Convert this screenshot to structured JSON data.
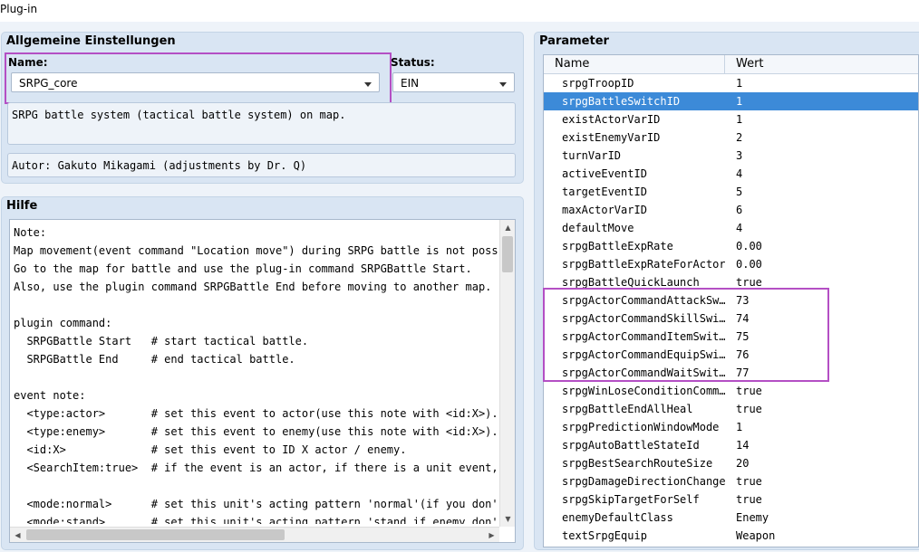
{
  "window": {
    "title": "Plug-in"
  },
  "general": {
    "title": "Allgemeine Einstellungen",
    "name_label": "Name:",
    "name_value": "SRPG_core",
    "status_label": "Status:",
    "status_value": "EIN",
    "description": "SRPG battle system (tactical battle system) on map.",
    "author": "Autor: Gakuto Mikagami (adjustments by Dr. Q)"
  },
  "help": {
    "title": "Hilfe",
    "lines": [
      "Note:",
      "Map movement(event command \"Location move\") during SRPG battle is not possible",
      "Go to the map for battle and use the plug-in command SRPGBattle Start.",
      "Also, use the plugin command SRPGBattle End before moving to another map.",
      "",
      "plugin command:",
      "  SRPGBattle Start   # start tactical battle.",
      "  SRPGBattle End     # end tactical battle.",
      "",
      "event note:",
      "  <type:actor>       # set this event to actor(use this note with <id:X>).",
      "  <type:enemy>       # set this event to enemy(use this note with <id:X>).",
      "  <id:X>             # set this event to ID X actor / enemy.",
      "  <SearchItem:true>  # if the event is an actor, if there is a unit event, it w",
      "",
      "  <mode:normal>      # set this unit's acting pattern 'normal'(if you don't set",
      "  <mode:stand>       # set this unit's acting pattern 'stand if enemy don't nea"
    ]
  },
  "parameters": {
    "title": "Parameter",
    "col_name": "Name",
    "col_value": "Wert",
    "rows": [
      {
        "name": "srpgTroopID",
        "value": "1"
      },
      {
        "name": "srpgBattleSwitchID",
        "value": "1"
      },
      {
        "name": "existActorVarID",
        "value": "1"
      },
      {
        "name": "existEnemyVarID",
        "value": "2"
      },
      {
        "name": "turnVarID",
        "value": "3"
      },
      {
        "name": "activeEventID",
        "value": "4"
      },
      {
        "name": "targetEventID",
        "value": "5"
      },
      {
        "name": "maxActorVarID",
        "value": "6"
      },
      {
        "name": "defaultMove",
        "value": "4"
      },
      {
        "name": "srpgBattleExpRate",
        "value": "0.00"
      },
      {
        "name": "srpgBattleExpRateForActors",
        "value": "0.00"
      },
      {
        "name": "srpgBattleQuickLaunch",
        "value": "true"
      },
      {
        "name": "srpgActorCommandAttackSw…",
        "value": "73"
      },
      {
        "name": "srpgActorCommandSkillSwi…",
        "value": "74"
      },
      {
        "name": "srpgActorCommandItemSwit…",
        "value": "75"
      },
      {
        "name": "srpgActorCommandEquipSwi…",
        "value": "76"
      },
      {
        "name": "srpgActorCommandWaitSwit…",
        "value": "77"
      },
      {
        "name": "srpgWinLoseConditionComm…",
        "value": "true"
      },
      {
        "name": "srpgBattleEndAllHeal",
        "value": "true"
      },
      {
        "name": "srpgPredictionWindowMode",
        "value": "1"
      },
      {
        "name": "srpgAutoBattleStateId",
        "value": "14"
      },
      {
        "name": "srpgBestSearchRouteSize",
        "value": "20"
      },
      {
        "name": "srpgDamageDirectionChange",
        "value": "true"
      },
      {
        "name": "srpgSkipTargetForSelf",
        "value": "true"
      },
      {
        "name": "enemyDefaultClass",
        "value": "Enemy"
      },
      {
        "name": "textSrpgEquip",
        "value": "Weapon"
      }
    ]
  }
}
